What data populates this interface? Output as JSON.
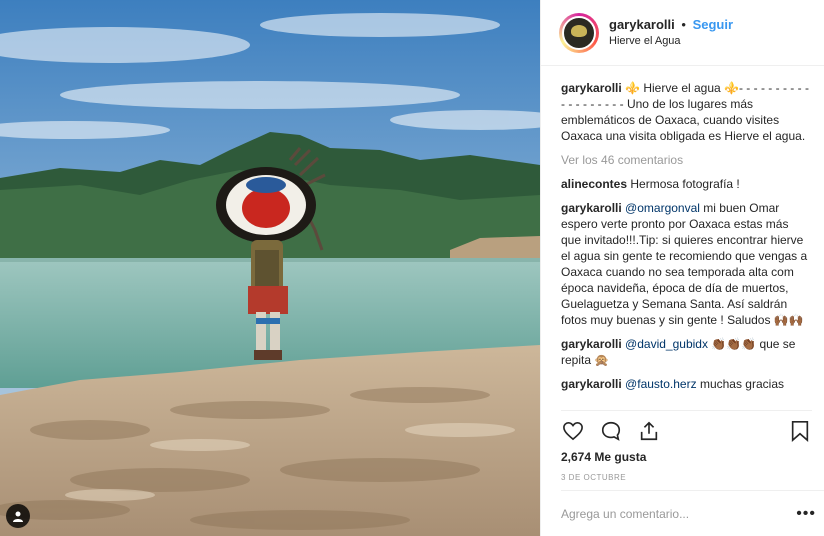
{
  "post": {
    "username": "garykarolli",
    "separator": "•",
    "follow_label": "Seguir",
    "location": "Hierve el Agua"
  },
  "caption": {
    "username": "garykarolli",
    "text": "⚜️ Hierve el agua ⚜️- - - - - - - - - - - - - - - - - - - Uno de los lugares más emblemáticos de Oaxaca, cuando visites Oaxaca una visita obligada es Hierve el agua."
  },
  "view_all_comments": "Ver los 46 comentarios",
  "comments": [
    {
      "username": "alinecontes",
      "mention": "",
      "text": "Hermosa fotografía !"
    },
    {
      "username": "garykarolli",
      "mention": "@omargonval",
      "text": "mi buen Omar espero verte pronto por Oaxaca estas más que invitado!!!.Tip: si quieres encontrar hierve el agua sin gente te recomiendo que vengas a Oaxaca cuando no sea temporada alta com época navideña, época de día de muertos, Guelaguetza y Semana Santa. Así saldrán fotos muy buenas y sin gente ! Saludos 🙌🏾🙌🏾"
    },
    {
      "username": "garykarolli",
      "mention": "@david_gubidx",
      "text": "👏🏾👏🏾👏🏾 que se repita 🙊"
    },
    {
      "username": "garykarolli",
      "mention": "@fausto.herz",
      "text": "muchas gracias"
    }
  ],
  "likes": "2,674 Me gusta",
  "date": "3 DE OCTUBRE",
  "add_comment_placeholder": "Agrega un comentario...",
  "more_label": "•••",
  "icons": {
    "like": "heart-icon",
    "comment": "comment-bubble-icon",
    "share": "share-icon",
    "save": "bookmark-icon",
    "user_tag": "user-tag-icon"
  }
}
